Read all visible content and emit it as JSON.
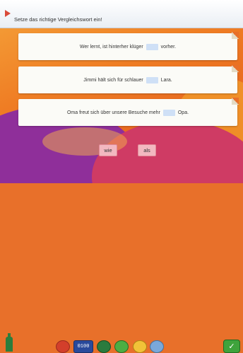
{
  "instruction": "Setze das richtige Vergleichswort ein!",
  "sentences": [
    {
      "before": "Wer lernt, ist hinterher klüger",
      "after": "vorher."
    },
    {
      "before": "Jimmi hält sich für schlauer",
      "after": "Lara."
    },
    {
      "before": "Oma freut sich über unsere Besuche mehr",
      "after": "Opa."
    }
  ],
  "options": [
    "wie",
    "als"
  ],
  "toolbar": {
    "counter_label": "0100",
    "ok_icon": "checkmark-icon"
  },
  "colors": {
    "card": "#fbfbf7",
    "slot": "#cfe0f6",
    "option": "#f2b8c0",
    "background": "#e8702a"
  }
}
